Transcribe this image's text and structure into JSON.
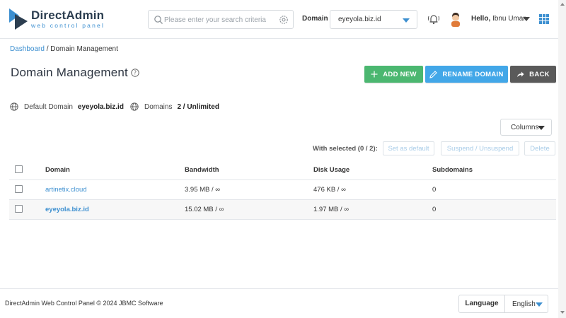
{
  "header": {
    "logo_title": "DirectAdmin",
    "logo_subtitle": "web control panel",
    "search_placeholder": "Please enter your search criteria",
    "domain_label": "Domain",
    "domain_value": "eyeyola.biz.id",
    "hello_prefix": "Hello,",
    "user_name": "Ibnu Umar"
  },
  "breadcrumb": {
    "home": "Dashboard",
    "separator": "/",
    "current": "Domain Management"
  },
  "page": {
    "title": "Domain Management"
  },
  "actions": {
    "add_new": "ADD NEW",
    "rename_domain": "RENAME DOMAIN",
    "back": "BACK"
  },
  "info": {
    "default_domain_label": "Default Domain",
    "default_domain_value": "eyeyola.biz.id",
    "domains_label": "Domains",
    "domains_value": "2 / Unlimited"
  },
  "toolbar": {
    "columns_label": "Columns",
    "with_selected": "With selected (0 / 2):",
    "set_default": "Set as default",
    "suspend": "Suspend / Unsuspend",
    "delete": "Delete"
  },
  "table": {
    "headers": [
      "Domain",
      "Bandwidth",
      "Disk Usage",
      "Subdomains"
    ],
    "rows": [
      {
        "domain": "artinetix.cloud",
        "bandwidth": "3.95 MB / ∞",
        "disk": "476 KB / ∞",
        "subdomains": "0"
      },
      {
        "domain": "eyeyola.biz.id",
        "bandwidth": "15.02 MB / ∞",
        "disk": "1.97 MB / ∞",
        "subdomains": "0"
      }
    ]
  },
  "footer": {
    "copyright": "DirectAdmin Web Control Panel © 2024 JBMC Software",
    "language_label": "Language",
    "language_value": "English"
  },
  "colors": {
    "accent": "#3c8fd0",
    "add_button": "#4bb770",
    "rename_button": "#42a7e8",
    "back_button": "#5a5a5a"
  }
}
